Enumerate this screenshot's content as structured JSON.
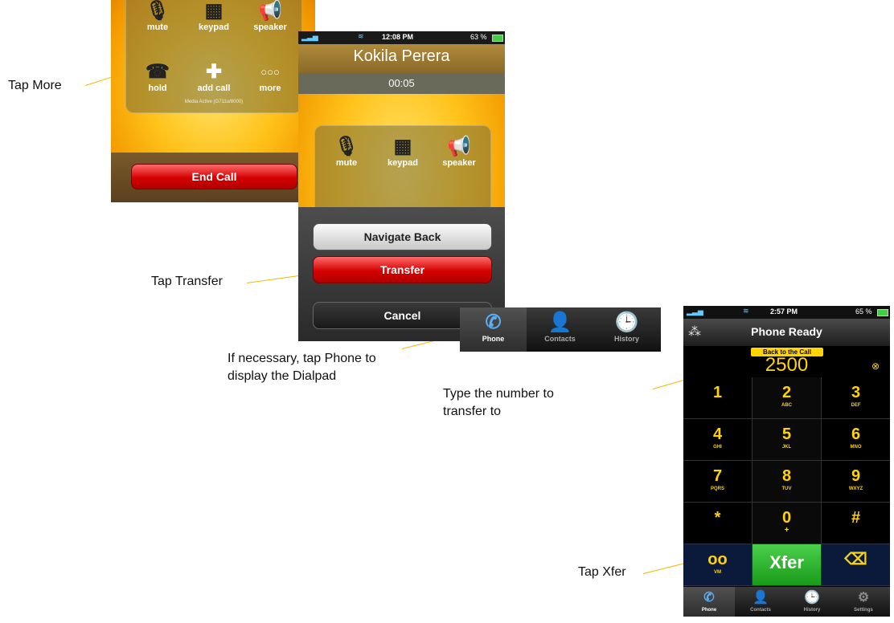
{
  "captions": {
    "tap_more": "Tap More",
    "tap_transfer": "Tap Transfer",
    "tap_phone_line1": "If necessary, tap Phone to",
    "tap_phone_line2": "display the Dialpad",
    "type_number_line1": "Type the number to",
    "type_number_line2": "transfer to",
    "tap_xfer": "Tap Xfer"
  },
  "screen1": {
    "buttons": [
      {
        "label": "mute",
        "icon": "🎙"
      },
      {
        "label": "keypad",
        "icon": "▦"
      },
      {
        "label": "speaker",
        "icon": "📢"
      },
      {
        "label": "hold",
        "icon": "☎"
      },
      {
        "label": "add call",
        "icon": "✚"
      },
      {
        "label": "more",
        "icon": "○○○"
      }
    ],
    "media_status": "Media Active (G711u/8000)",
    "end_call": "End Call"
  },
  "screen2": {
    "status": {
      "time": "12:08 PM",
      "battery": "63 %"
    },
    "caller_name": "Kokila Perera",
    "timer": "00:05",
    "buttons": [
      {
        "label": "mute",
        "icon": "🎙"
      },
      {
        "label": "keypad",
        "icon": "▦"
      },
      {
        "label": "speaker",
        "icon": "📢"
      }
    ],
    "sheet": {
      "navigate_back": "Navigate Back",
      "transfer": "Transfer",
      "cancel": "Cancel"
    }
  },
  "tabbar": {
    "tabs": [
      {
        "label": "Phone",
        "icon": "✆"
      },
      {
        "label": "Contacts",
        "icon": "👤"
      },
      {
        "label": "History",
        "icon": "🕒"
      }
    ]
  },
  "screen3": {
    "status": {
      "time": "2:57 PM",
      "battery": "65 %"
    },
    "title": "Phone Ready",
    "back_to_call": "Back to the Call",
    "number": "2500",
    "clear_icon": "⊗",
    "keys": [
      {
        "digit": "1",
        "letters": ""
      },
      {
        "digit": "2",
        "letters": "ABC"
      },
      {
        "digit": "3",
        "letters": "DEF"
      },
      {
        "digit": "4",
        "letters": "GHI"
      },
      {
        "digit": "5",
        "letters": "JKL"
      },
      {
        "digit": "6",
        "letters": "MNO"
      },
      {
        "digit": "7",
        "letters": "PQRS"
      },
      {
        "digit": "8",
        "letters": "TUV"
      },
      {
        "digit": "9",
        "letters": "WXYZ"
      },
      {
        "digit": "*",
        "letters": ""
      },
      {
        "digit": "0",
        "letters": "+"
      },
      {
        "digit": "#",
        "letters": ""
      }
    ],
    "vm": {
      "icon": "oo",
      "label": "VM"
    },
    "xfer": "Xfer",
    "delete_icon": "⌫",
    "tabs": [
      {
        "label": "Phone",
        "icon": "✆"
      },
      {
        "label": "Contacts",
        "icon": "👤"
      },
      {
        "label": "History",
        "icon": "🕒"
      },
      {
        "label": "Settings",
        "icon": "⚙"
      }
    ]
  }
}
